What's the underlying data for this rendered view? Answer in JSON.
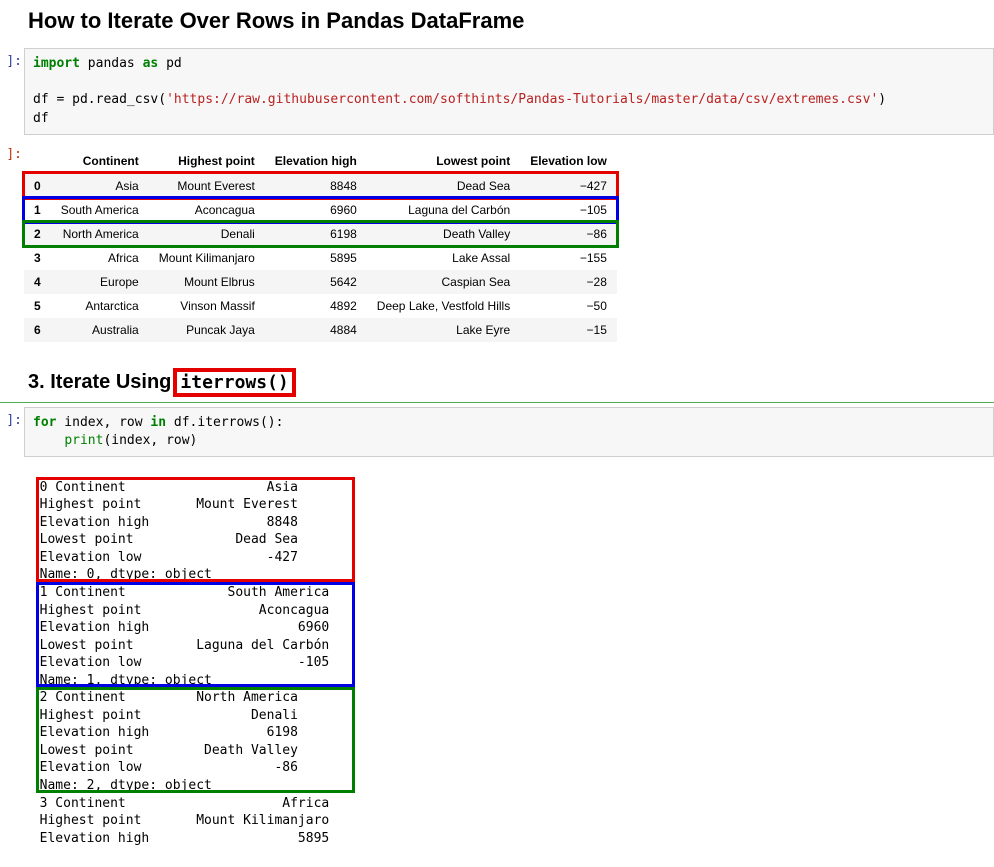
{
  "title": "How to Iterate Over Rows in Pandas DataFrame",
  "cell1": {
    "prompt": " ]:",
    "code_tokens": [
      {
        "t": "import",
        "c": "kw-green"
      },
      {
        "t": " pandas ",
        "c": ""
      },
      {
        "t": "as",
        "c": "kw-green"
      },
      {
        "t": " pd\n\n",
        "c": ""
      },
      {
        "t": "df ",
        "c": ""
      },
      {
        "t": "=",
        "c": ""
      },
      {
        "t": " pd.read_csv(",
        "c": ""
      },
      {
        "t": "'https://raw.githubusercontent.com/softhints/Pandas-Tutorials/master/data/csv/extremes.csv'",
        "c": "str-red"
      },
      {
        "t": ")\n",
        "c": ""
      },
      {
        "t": "df",
        "c": ""
      }
    ]
  },
  "out_prompt": " ]:",
  "table": {
    "columns": [
      "Continent",
      "Highest point",
      "Elevation high",
      "Lowest point",
      "Elevation low"
    ],
    "rows": [
      {
        "idx": "0",
        "cells": [
          "Asia",
          "Mount Everest",
          "8848",
          "Dead Sea",
          "−427"
        ]
      },
      {
        "idx": "1",
        "cells": [
          "South America",
          "Aconcagua",
          "6960",
          "Laguna del Carbón",
          "−105"
        ]
      },
      {
        "idx": "2",
        "cells": [
          "North America",
          "Denali",
          "6198",
          "Death Valley",
          "−86"
        ]
      },
      {
        "idx": "3",
        "cells": [
          "Africa",
          "Mount Kilimanjaro",
          "5895",
          "Lake Assal",
          "−155"
        ]
      },
      {
        "idx": "4",
        "cells": [
          "Europe",
          "Mount Elbrus",
          "5642",
          "Caspian Sea",
          "−28"
        ]
      },
      {
        "idx": "5",
        "cells": [
          "Antarctica",
          "Vinson Massif",
          "4892",
          "Deep Lake, Vestfold Hills",
          "−50"
        ]
      },
      {
        "idx": "6",
        "cells": [
          "Australia",
          "Puncak Jaya",
          "4884",
          "Lake Eyre",
          "−15"
        ]
      }
    ]
  },
  "section": {
    "pre": "3. Iterate Using",
    "code": "iterrows()"
  },
  "cell2": {
    "prompt": " ]:",
    "code_tokens": [
      {
        "t": "for",
        "c": "kw-green"
      },
      {
        "t": " index, row ",
        "c": ""
      },
      {
        "t": "in",
        "c": "kw-green"
      },
      {
        "t": " df.iterrows():\n    ",
        "c": ""
      },
      {
        "t": "print",
        "c": "fn-green"
      },
      {
        "t": "(index, row)",
        "c": ""
      }
    ]
  },
  "output_blocks": [
    {
      "color": "red",
      "lines": [
        "0 Continent                  Asia",
        "Highest point       Mount Everest",
        "Elevation high               8848",
        "Lowest point             Dead Sea",
        "Elevation low                -427",
        "Name: 0, dtype: object"
      ]
    },
    {
      "color": "blue",
      "lines": [
        "1 Continent             South America",
        "Highest point               Aconcagua",
        "Elevation high                   6960",
        "Lowest point        Laguna del Carbón",
        "Elevation low                    -105",
        "Name: 1, dtype: object"
      ]
    },
    {
      "color": "green",
      "lines": [
        "2 Continent         North America",
        "Highest point              Denali",
        "Elevation high               6198",
        "Lowest point         Death Valley",
        "Elevation low                 -86",
        "Name: 2, dtype: object"
      ]
    },
    {
      "color": "",
      "lines": [
        "3 Continent                    Africa",
        "Highest point       Mount Kilimanjaro",
        "Elevation high                   5895"
      ]
    }
  ]
}
